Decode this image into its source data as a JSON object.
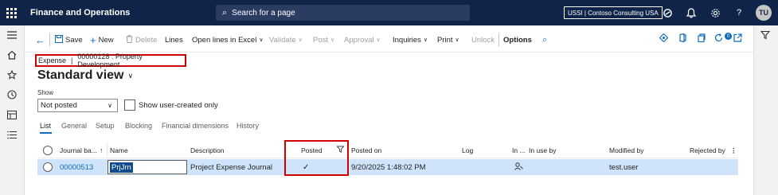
{
  "topbar": {
    "app_title": "Finance and Operations",
    "search_placeholder": "Search for a page",
    "company": "USSI | Contoso Consulting USA",
    "avatar_initials": "TU"
  },
  "actions": {
    "save": "Save",
    "new": "New",
    "delete": "Delete",
    "lines": "Lines",
    "open_lines_excel": "Open lines in Excel",
    "validate": "Validate",
    "post": "Post",
    "approval": "Approval",
    "inquiries": "Inquiries",
    "print": "Print",
    "unlock": "Unlock",
    "options": "Options",
    "notification_count": "0"
  },
  "caption": {
    "journal_type": "Expense",
    "separator": "|",
    "record": "00000128 : Property Development"
  },
  "view": {
    "name": "Standard view"
  },
  "filter": {
    "show_label": "Show",
    "show_value": "Not posted",
    "show_user_created_label": "Show user-created only",
    "show_user_created_checked": false
  },
  "tabs": [
    "List",
    "General",
    "Setup",
    "Blocking",
    "Financial dimensions",
    "History"
  ],
  "active_tab": "List",
  "grid": {
    "columns": {
      "journal_batch": "Journal ba...",
      "name": "Name",
      "description": "Description",
      "posted": "Posted",
      "posted_on": "Posted on",
      "log": "Log",
      "in_use": "In ...",
      "in_use_by": "In use by",
      "modified_by": "Modified by",
      "rejected_by": "Rejected by"
    },
    "rows": [
      {
        "journal_batch": "00000513",
        "name": "PrjJrn",
        "description": "Project Expense Journal",
        "posted": "✓",
        "posted_on": "9/20/2025 1:48:02 PM",
        "log": "",
        "in_use_by": "",
        "modified_by": "test.user",
        "rejected_by": ""
      }
    ]
  },
  "colors": {
    "nav_bar": "#0f2448",
    "accent": "#0f6cbd",
    "selected_row": "#cfe4fa",
    "highlight_box": "#d00000"
  }
}
